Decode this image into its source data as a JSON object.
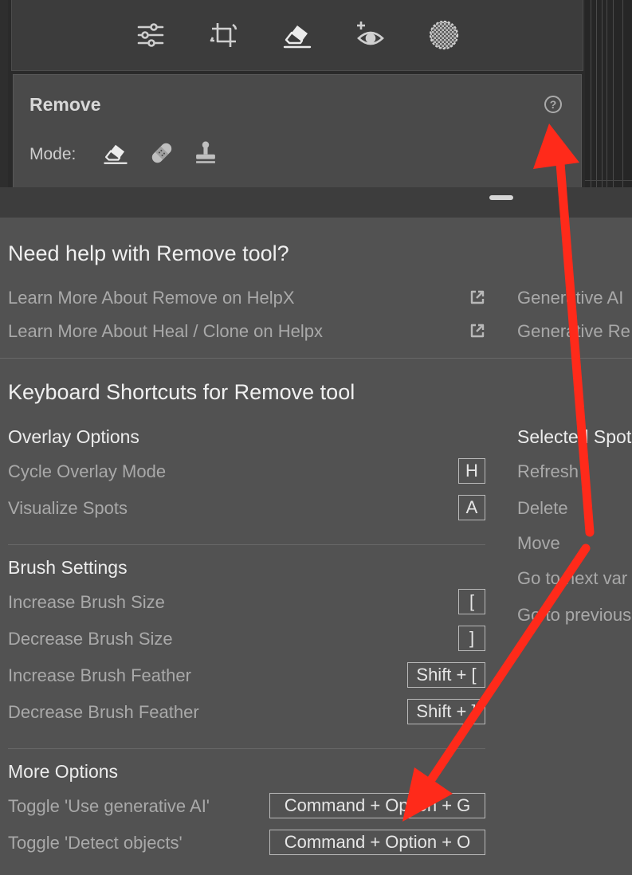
{
  "toolbar": {
    "icons": [
      "sliders-icon",
      "crop-icon",
      "eraser-icon",
      "redeye-icon",
      "masking-icon"
    ]
  },
  "remove_panel": {
    "title": "Remove",
    "help_glyph": "?",
    "mode_label": "Mode:",
    "mode_icons": [
      "eraser-mode-icon",
      "bandage-mode-icon",
      "stamp-mode-icon"
    ]
  },
  "help_popup": {
    "heading": "Need help with Remove tool?",
    "links": [
      "Learn More About Remove on HelpX",
      "Learn More About Heal / Clone on Helpx"
    ],
    "right_links": [
      "Generative AI",
      "Generative Re"
    ],
    "shortcuts_heading": "Keyboard Shortcuts for Remove tool",
    "overlay": {
      "heading": "Overlay Options",
      "items": [
        {
          "label": "Cycle Overlay Mode",
          "key": "H"
        },
        {
          "label": "Visualize Spots",
          "key": "A"
        }
      ]
    },
    "brush": {
      "heading": "Brush Settings",
      "items": [
        {
          "label": "Increase Brush Size",
          "key": "["
        },
        {
          "label": "Decrease Brush Size",
          "key": "]"
        },
        {
          "label": "Increase Brush Feather",
          "key": "Shift + ["
        },
        {
          "label": "Decrease Brush Feather",
          "key": "Shift + ]"
        }
      ]
    },
    "more": {
      "heading": "More Options",
      "items": [
        {
          "label": "Toggle 'Use generative AI'",
          "key": "Command + Option + G"
        },
        {
          "label": "Toggle 'Detect objects'",
          "key": "Command + Option + O"
        }
      ]
    },
    "selected_spot": {
      "heading": "Selected Spot",
      "items": [
        "Refresh",
        "Delete",
        "Move",
        "Go to next var",
        "Go to previous"
      ]
    }
  },
  "annotation": {
    "arrow_color": "#ff2a1a"
  }
}
